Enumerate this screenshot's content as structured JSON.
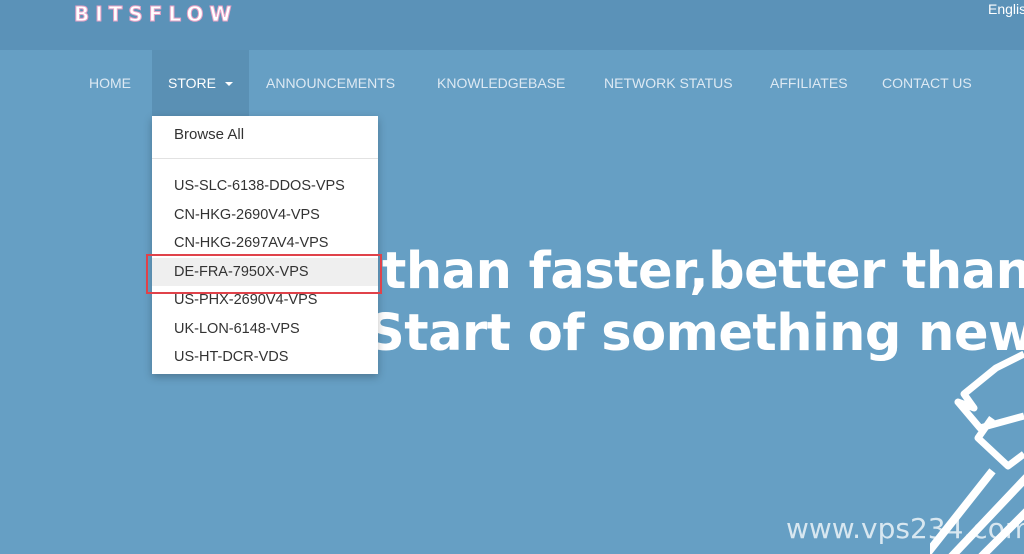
{
  "header": {
    "logo": "BITSFLOW",
    "language": "English"
  },
  "nav": {
    "items": [
      {
        "label": "HOME"
      },
      {
        "label": "STORE"
      },
      {
        "label": "ANNOUNCEMENTS"
      },
      {
        "label": "KNOWLEDGEBASE"
      },
      {
        "label": "NETWORK STATUS"
      },
      {
        "label": "AFFILIATES"
      },
      {
        "label": "CONTACT US"
      }
    ],
    "active": "STORE"
  },
  "dropdown": {
    "browse_all": "Browse All",
    "items": [
      {
        "label": "US-SLC-6138-DDOS-VPS"
      },
      {
        "label": "CN-HKG-2690V4-VPS"
      },
      {
        "label": "CN-HKG-2697AV4-VPS"
      },
      {
        "label": "DE-FRA-7950X-VPS"
      },
      {
        "label": "US-PHX-2690V4-VPS"
      },
      {
        "label": "UK-LON-6148-VPS"
      },
      {
        "label": "US-HT-DCR-VDS"
      }
    ],
    "highlighted": "DE-FRA-7950X-VPS",
    "highlight_color": "#e0424a"
  },
  "hero": {
    "line1": "than faster,better than",
    "line2": "Start of something new"
  },
  "watermark": "www.vps234.com",
  "colors": {
    "background": "#669fc4",
    "topbar": "#5b92b8",
    "active_nav": "#5a90b4"
  }
}
